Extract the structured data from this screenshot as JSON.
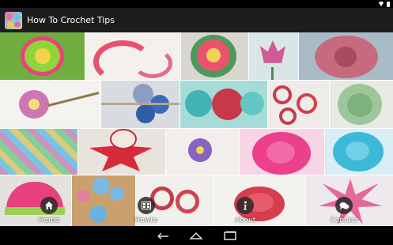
{
  "app": {
    "title": "How To Crochet Tips"
  },
  "colors": {
    "actionbar": "#1d1d1d",
    "accent": "#ffffff"
  },
  "nav": [
    {
      "label": "Home",
      "icon": "home-icon"
    },
    {
      "label": "Howto",
      "icon": "film-icon"
    },
    {
      "label": "About",
      "icon": "info-icon"
    },
    {
      "label": "Contact",
      "icon": "chat-icon"
    }
  ]
}
